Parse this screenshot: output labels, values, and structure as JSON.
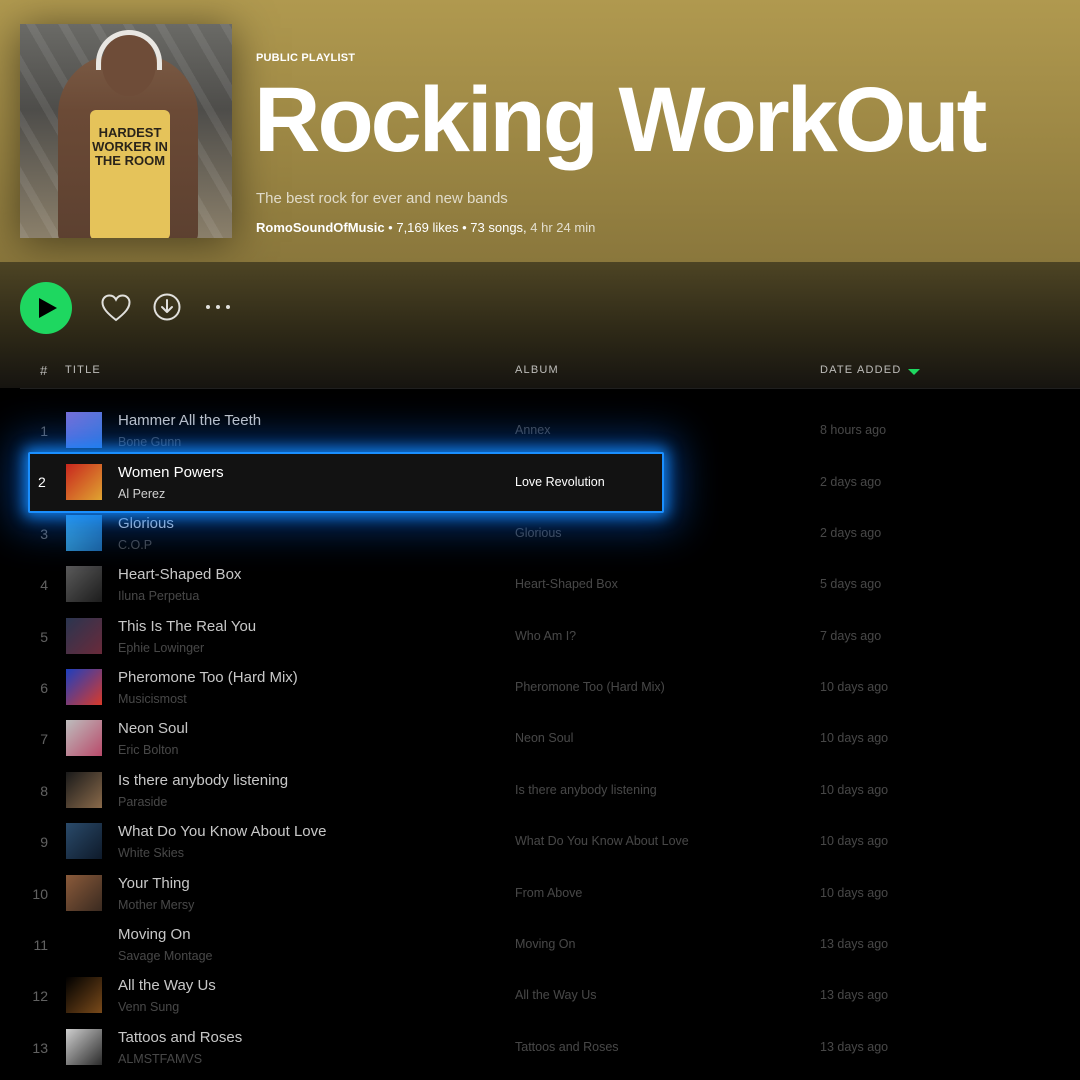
{
  "playlist": {
    "eyebrow": "PUBLIC PLAYLIST",
    "title": "Rocking WorkOut",
    "description": "The best rock for ever and new bands",
    "owner": "RomoSoundOfMusic",
    "likes": "7,169 likes",
    "songs": "73 songs,",
    "duration": "4 hr 24 min",
    "cover_shirt_text": "HARDEST WORKER IN THE ROOM",
    "header_color": "#b0994f"
  },
  "actions": {
    "play_icon": "play-icon",
    "like_icon": "heart-icon",
    "download_icon": "download-icon",
    "more_icon": "more-icon",
    "accent_color": "#1ed760"
  },
  "columns": {
    "num": "#",
    "title": "TITLE",
    "album": "ALBUM",
    "date_added": "DATE ADDED"
  },
  "tracks": [
    {
      "num": "1",
      "title": "Hammer All the Teeth",
      "artist": "Bone Gunn",
      "album": "Annex",
      "date": "8 hours ago",
      "thumb": [
        "#7a6fd8",
        "#3d7ad9"
      ]
    },
    {
      "num": "2",
      "title": "Women Powers",
      "artist": "Al Perez",
      "album": "Love Revolution",
      "date": "2 days ago",
      "thumb": [
        "#c8261e",
        "#e0a431"
      ]
    },
    {
      "num": "3",
      "title": "Glorious",
      "artist": "C.O.P",
      "album": "Glorious",
      "date": "2 days ago",
      "thumb": [
        "#3aa6d8",
        "#1b5f9a"
      ]
    },
    {
      "num": "4",
      "title": "Heart-Shaped Box",
      "artist": "Iluna Perpetua",
      "album": "Heart-Shaped Box",
      "date": "5 days ago",
      "thumb": [
        "#5a5a5a",
        "#1c1c1c"
      ]
    },
    {
      "num": "5",
      "title": "This Is The Real You",
      "artist": "Ephie Lowinger",
      "album": "Who Am I?",
      "date": "7 days ago",
      "thumb": [
        "#2a3550",
        "#6a2a3a"
      ]
    },
    {
      "num": "6",
      "title": "Pheromone Too (Hard Mix)",
      "artist": "Musicismost",
      "album": "Pheromone Too (Hard Mix)",
      "date": "10 days ago",
      "thumb": [
        "#1d3fbf",
        "#d93a2a"
      ]
    },
    {
      "num": "7",
      "title": "Neon Soul",
      "artist": "Eric Bolton",
      "album": "Neon Soul",
      "date": "10 days ago",
      "thumb": [
        "#bdbdbd",
        "#b94a6a"
      ]
    },
    {
      "num": "8",
      "title": "Is there anybody listening",
      "artist": "Paraside",
      "album": "Is there anybody listening",
      "date": "10 days ago",
      "thumb": [
        "#1a1a1a",
        "#8a6a4a"
      ]
    },
    {
      "num": "9",
      "title": "What Do You Know About Love",
      "artist": "White Skies",
      "album": "What Do You Know About Love",
      "date": "10 days ago",
      "thumb": [
        "#2a4a6a",
        "#0e1a2a"
      ]
    },
    {
      "num": "10",
      "title": "Your Thing",
      "artist": "Mother Mersy",
      "album": "From Above",
      "date": "10 days ago",
      "thumb": [
        "#8a5a3a",
        "#3a2a20"
      ]
    },
    {
      "num": "11",
      "title": "Moving On",
      "artist": "Savage Montage",
      "album": "Moving On",
      "date": "13 days ago",
      "thumb": [
        "#000000",
        "#000000"
      ]
    },
    {
      "num": "12",
      "title": "All the Way Us",
      "artist": "Venn Sung",
      "album": "All the Way Us",
      "date": "13 days ago",
      "thumb": [
        "#000000",
        "#7a4a1a"
      ]
    },
    {
      "num": "13",
      "title": "Tattoos and Roses",
      "artist": "ALMSTFAMVS",
      "album": "Tattoos and Roses",
      "date": "13 days ago",
      "thumb": [
        "#cfcfcf",
        "#2a2a2a"
      ]
    }
  ],
  "highlight": {
    "focus_color": "#1a8fff"
  }
}
